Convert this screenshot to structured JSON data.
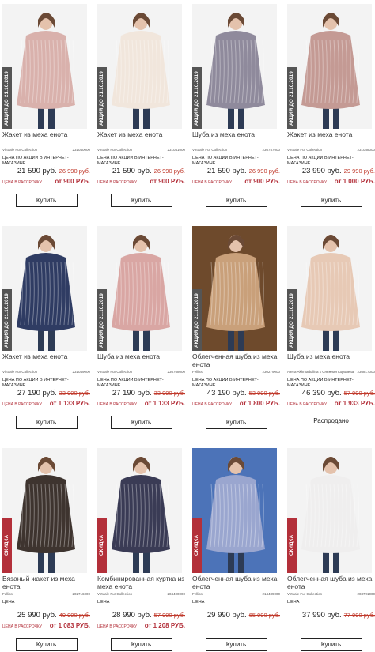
{
  "products": [
    {
      "title": "Жакет из меха енота",
      "brand": "Virtuale Fur Collection",
      "sku": "231040000",
      "promo": "ЦЕНА ПО АКЦИИ В ИНТЕРНЕТ-МАГАЗИНЕ",
      "price": "21 590 руб.",
      "old_price": "26 990 руб.",
      "installment_label": "ЦЕНА В РАССРОЧКУ",
      "installment_price": "от 900 РУБ.",
      "ribbon": "АКЦИЯ ДО 21.10.2019",
      "ribbon_type": "promo",
      "action": "Купить",
      "fur": "#d9b1ac",
      "bg": "#f3f3f3"
    },
    {
      "title": "Жакет из меха енота",
      "brand": "Virtuale Fur Collection",
      "sku": "231041000",
      "promo": "ЦЕНА ПО АКЦИИ В ИНТЕРНЕТ-МАГАЗИНЕ",
      "price": "21 590 руб.",
      "old_price": "26 990 руб.",
      "installment_label": "ЦЕНА В РАССРОЧКУ",
      "installment_price": "от 900 РУБ.",
      "ribbon": "АКЦИЯ ДО 21.10.2019",
      "ribbon_type": "promo",
      "action": "Купить",
      "fur": "#f1e6dc",
      "bg": "#f3f3f3"
    },
    {
      "title": "Шуба из меха енота",
      "brand": "Virtuale Fur Collection",
      "sku": "236757000",
      "promo": "ЦЕНА ПО АКЦИИ В ИНТЕРНЕТ-МАГАЗИНЕ",
      "price": "21 590 руб.",
      "old_price": "26 990 руб.",
      "installment_label": "ЦЕНА В РАССРОЧКУ",
      "installment_price": "от 900 РУБ.",
      "ribbon": "АКЦИЯ ДО 21.10.2019",
      "ribbon_type": "promo",
      "action": "Купить",
      "fur": "#8f8a9c",
      "bg": "#f3f3f3"
    },
    {
      "title": "Жакет из меха енота",
      "brand": "Virtuale Fur Collection",
      "sku": "231038000",
      "promo": "ЦЕНА ПО АКЦИИ В ИНТЕРНЕТ-МАГАЗИНЕ",
      "price": "23 990 руб.",
      "old_price": "29 990 руб.",
      "installment_label": "ЦЕНА В РАССРОЧКУ",
      "installment_price": "от 1 000 РУБ.",
      "ribbon": "АКЦИЯ ДО 21.10.2019",
      "ribbon_type": "promo",
      "action": "Купить",
      "fur": "#c49a94",
      "bg": "#f3f3f3"
    },
    {
      "title": "Жакет из меха енота",
      "brand": "Virtuale Fur Collection",
      "sku": "231049000",
      "promo": "ЦЕНА ПО АКЦИИ В ИНТЕРНЕТ-МАГАЗИНЕ",
      "price": "27 190 руб.",
      "old_price": "33 990 руб.",
      "installment_label": "ЦЕНА В РАССРОЧКУ",
      "installment_price": "от 1 133 РУБ.",
      "ribbon": "АКЦИЯ ДО 21.10.2019",
      "ribbon_type": "promo",
      "action": "Купить",
      "fur": "#2f3c63",
      "bg": "#f3f3f3"
    },
    {
      "title": "Шуба из меха енота",
      "brand": "Virtuale Fur Collection",
      "sku": "236768000",
      "promo": "ЦЕНА ПО АКЦИИ В ИНТЕРНЕТ-МАГАЗИНЕ",
      "price": "27 190 руб.",
      "old_price": "33 990 руб.",
      "installment_label": "ЦЕНА В РАССРОЧКУ",
      "installment_price": "от 1 133 РУБ.",
      "ribbon": "АКЦИЯ ДО 21.10.2019",
      "ribbon_type": "promo",
      "action": "Купить",
      "fur": "#d9a6a3",
      "bg": "#f3f3f3"
    },
    {
      "title": "Облегченная шуба из меха енота",
      "brand": "Fellissi",
      "sku": "230279000",
      "promo": "ЦЕНА ПО АКЦИИ В ИНТЕРНЕТ-МАГАЗИНЕ",
      "price": "43 190 руб.",
      "old_price": "53 990 руб.",
      "installment_label": "ЦЕНА В РАССРОЧКУ",
      "installment_price": "от 1 800 РУБ.",
      "ribbon": "АКЦИЯ ДО 21.10.2019",
      "ribbon_type": "promo",
      "action": "Купить",
      "fur": "#c9a07a",
      "bg": "#6e4a2c"
    },
    {
      "title": "Шуба из меха енота",
      "brand": "Alena Akhmadullina x Снежная Королева",
      "sku": "236817000",
      "promo": "ЦЕНА ПО АКЦИИ В ИНТЕРНЕТ-МАГАЗИНЕ",
      "price": "46 390 руб.",
      "old_price": "57 990 руб.",
      "installment_label": "ЦЕНА В РАССРОЧКУ",
      "installment_price": "от 1 933 РУБ.",
      "ribbon": "АКЦИЯ ДО 21.10.2019",
      "ribbon_type": "promo",
      "status": "Распродано",
      "fur": "#e7c9b5",
      "bg": "#f3f3f3"
    },
    {
      "title": "Вязаный жакет из меха енота",
      "brand": "Fellissi",
      "sku": "202716000",
      "promo": "ЦЕНА",
      "price": "25 990 руб.",
      "old_price": "49 990 руб.",
      "installment_label": "ЦЕНА В РАССРОЧКУ",
      "installment_price": "от 1 083 РУБ.",
      "ribbon": "СКИДКА",
      "ribbon_type": "sale",
      "action": "Купить",
      "fur": "#3e342f",
      "bg": "#f3f3f3"
    },
    {
      "title": "Комбинированная куртка из меха енота",
      "brand": "Virtuale Fur Collection",
      "sku": "204400000",
      "promo": "ЦЕНА",
      "price": "28 990 руб.",
      "old_price": "57 990 руб.",
      "installment_label": "ЦЕНА В РАССРОЧКУ",
      "installment_price": "от 1 208 РУБ.",
      "ribbon": "СКИДКА",
      "ribbon_type": "sale",
      "action": "Купить",
      "fur": "#3a3b55",
      "bg": "#f3f3f3"
    },
    {
      "title": "Облегченная шуба из меха енота",
      "brand": "Fellissi",
      "sku": "214489000",
      "promo": "ЦЕНА",
      "price": "29 990 руб.",
      "old_price": "65 990 руб.",
      "installment_label": "",
      "installment_price": "",
      "ribbon": "СКИДКА",
      "ribbon_type": "sale",
      "action": "Купить",
      "fur": "#9aa6cf",
      "bg": "#4c73b8"
    },
    {
      "title": "Облегченная шуба из меха енота",
      "brand": "Virtuale Fur Collection",
      "sku": "203701000",
      "promo": "ЦЕНА",
      "price": "37 990 руб.",
      "old_price": "77 990 руб.",
      "installment_label": "",
      "installment_price": "",
      "ribbon": "СКИДКА",
      "ribbon_type": "sale",
      "action": "Купить",
      "fur": "#efeeee",
      "bg": "#f3f3f3"
    }
  ]
}
